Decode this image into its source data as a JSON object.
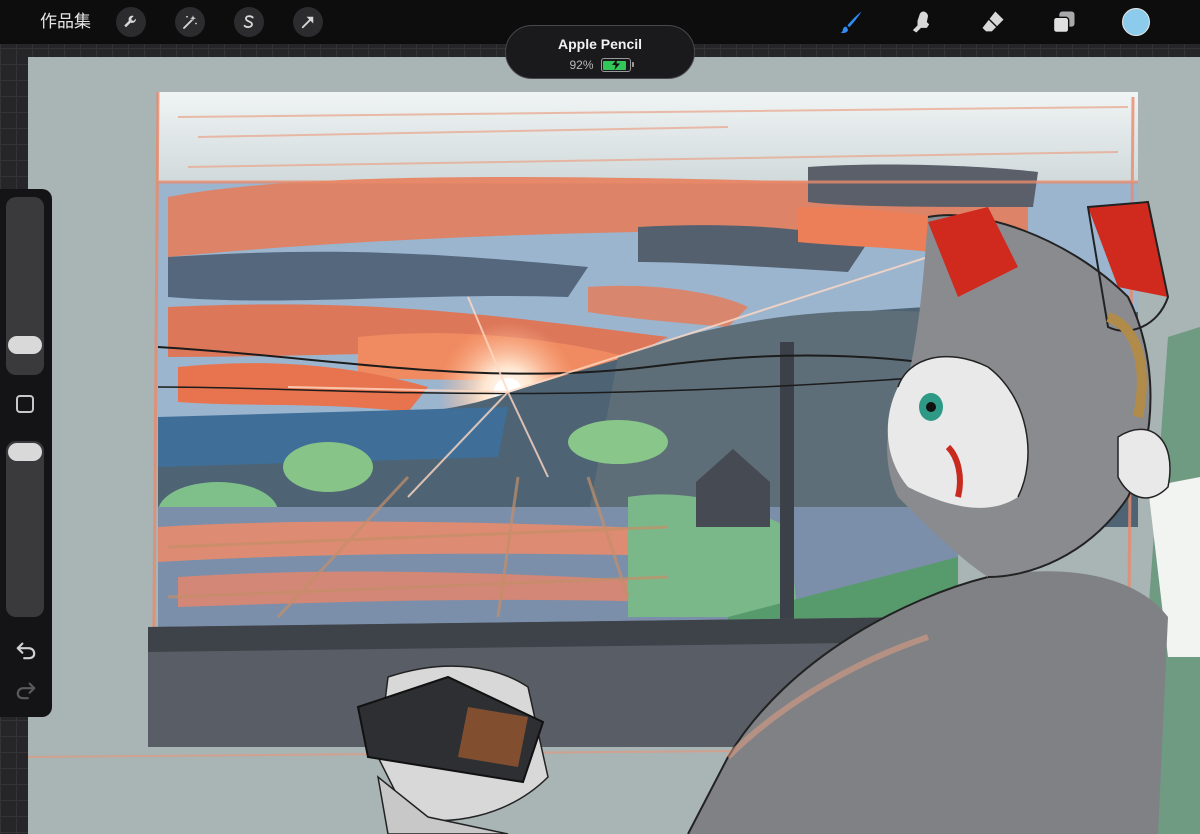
{
  "toolbar": {
    "gallery_label": "作品集",
    "left_tools": [
      "wrench-icon",
      "magic-wand-icon",
      "selection-s-icon",
      "transform-arrow-icon"
    ],
    "right_tools": [
      "brush-icon",
      "smudge-icon",
      "eraser-icon",
      "layers-icon"
    ],
    "active_tool": "brush-icon",
    "current_color": "#8ccbec",
    "accent_color": "#2f8cf5"
  },
  "pencil_status": {
    "name": "Apple Pencil",
    "battery_text": "92%",
    "battery_level": 0.92,
    "battery_color": "#31c759"
  },
  "sidebar": {
    "brush_size_level": 0.12,
    "opacity_level": 1.0,
    "modify_icon": "square-icon",
    "undo_icon": "undo-icon",
    "redo_icon": "redo-icon"
  },
  "canvas": {
    "artwork": "painting",
    "palette": [
      "#dfe6e6",
      "#e97a55",
      "#4c5e73",
      "#8aa9c9",
      "#88c68a",
      "#5b6067",
      "#808185"
    ]
  }
}
